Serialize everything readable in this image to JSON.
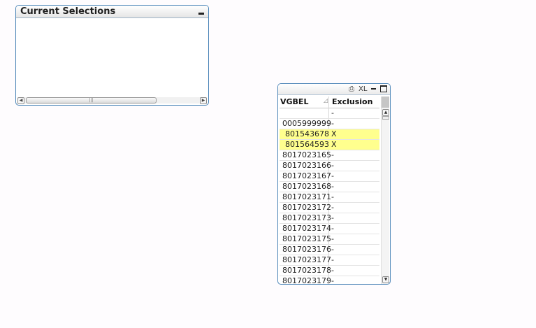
{
  "current_selections": {
    "title": "Current Selections"
  },
  "table_box": {
    "caption_buttons": {
      "print": "⎙",
      "xl": "XL"
    },
    "columns": [
      "VGBEL",
      "Exclusion"
    ],
    "rows": [
      {
        "vgbel": "",
        "exclusion": "-",
        "selected": false
      },
      {
        "vgbel": "0005999999",
        "exclusion": "-",
        "selected": false
      },
      {
        "vgbel": "801543678",
        "exclusion": "X",
        "selected": true
      },
      {
        "vgbel": "801564593",
        "exclusion": "X",
        "selected": true
      },
      {
        "vgbel": "8017023165",
        "exclusion": "-",
        "selected": false
      },
      {
        "vgbel": "8017023166",
        "exclusion": "-",
        "selected": false
      },
      {
        "vgbel": "8017023167",
        "exclusion": "-",
        "selected": false
      },
      {
        "vgbel": "8017023168",
        "exclusion": "-",
        "selected": false
      },
      {
        "vgbel": "8017023171",
        "exclusion": "-",
        "selected": false
      },
      {
        "vgbel": "8017023172",
        "exclusion": "-",
        "selected": false
      },
      {
        "vgbel": "8017023173",
        "exclusion": "-",
        "selected": false
      },
      {
        "vgbel": "8017023174",
        "exclusion": "-",
        "selected": false
      },
      {
        "vgbel": "8017023175",
        "exclusion": "-",
        "selected": false
      },
      {
        "vgbel": "8017023176",
        "exclusion": "-",
        "selected": false
      },
      {
        "vgbel": "8017023177",
        "exclusion": "-",
        "selected": false
      },
      {
        "vgbel": "8017023178",
        "exclusion": "-",
        "selected": false
      },
      {
        "vgbel": "8017023179",
        "exclusion": "-",
        "selected": false
      }
    ],
    "highlight_color": "#ffff8e"
  }
}
